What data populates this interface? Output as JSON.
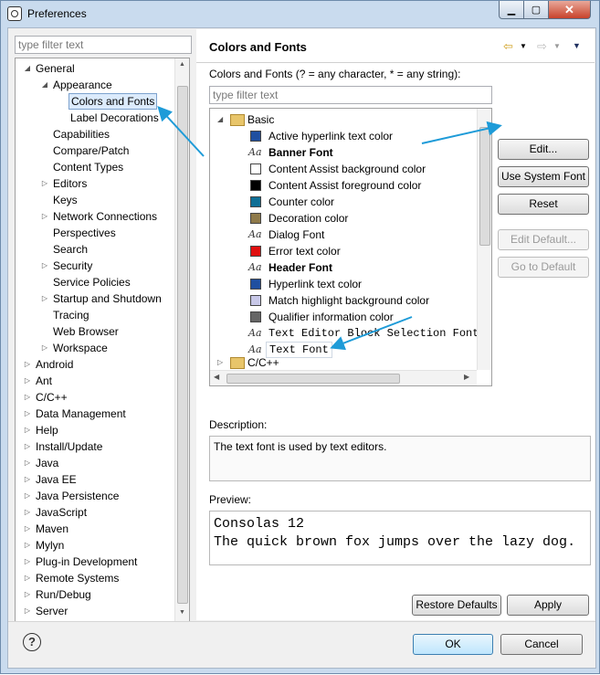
{
  "window": {
    "title": "Preferences"
  },
  "filter_placeholder": "type filter text",
  "tree": [
    {
      "label": "General",
      "level": 0,
      "expander": "down"
    },
    {
      "label": "Appearance",
      "level": 1,
      "expander": "down"
    },
    {
      "label": "Colors and Fonts",
      "level": 2,
      "expander": "",
      "selected": true
    },
    {
      "label": "Label Decorations",
      "level": 2,
      "expander": ""
    },
    {
      "label": "Capabilities",
      "level": 1,
      "expander": ""
    },
    {
      "label": "Compare/Patch",
      "level": 1,
      "expander": ""
    },
    {
      "label": "Content Types",
      "level": 1,
      "expander": ""
    },
    {
      "label": "Editors",
      "level": 1,
      "expander": "right"
    },
    {
      "label": "Keys",
      "level": 1,
      "expander": ""
    },
    {
      "label": "Network Connections",
      "level": 1,
      "expander": "right"
    },
    {
      "label": "Perspectives",
      "level": 1,
      "expander": ""
    },
    {
      "label": "Search",
      "level": 1,
      "expander": ""
    },
    {
      "label": "Security",
      "level": 1,
      "expander": "right"
    },
    {
      "label": "Service Policies",
      "level": 1,
      "expander": ""
    },
    {
      "label": "Startup and Shutdown",
      "level": 1,
      "expander": "right"
    },
    {
      "label": "Tracing",
      "level": 1,
      "expander": ""
    },
    {
      "label": "Web Browser",
      "level": 1,
      "expander": ""
    },
    {
      "label": "Workspace",
      "level": 1,
      "expander": "right"
    },
    {
      "label": "Android",
      "level": 0,
      "expander": "right"
    },
    {
      "label": "Ant",
      "level": 0,
      "expander": "right"
    },
    {
      "label": "C/C++",
      "level": 0,
      "expander": "right"
    },
    {
      "label": "Data Management",
      "level": 0,
      "expander": "right"
    },
    {
      "label": "Help",
      "level": 0,
      "expander": "right"
    },
    {
      "label": "Install/Update",
      "level": 0,
      "expander": "right"
    },
    {
      "label": "Java",
      "level": 0,
      "expander": "right"
    },
    {
      "label": "Java EE",
      "level": 0,
      "expander": "right"
    },
    {
      "label": "Java Persistence",
      "level": 0,
      "expander": "right"
    },
    {
      "label": "JavaScript",
      "level": 0,
      "expander": "right"
    },
    {
      "label": "Maven",
      "level": 0,
      "expander": "right"
    },
    {
      "label": "Mylyn",
      "level": 0,
      "expander": "right"
    },
    {
      "label": "Plug-in Development",
      "level": 0,
      "expander": "right"
    },
    {
      "label": "Remote Systems",
      "level": 0,
      "expander": "right"
    },
    {
      "label": "Run/Debug",
      "level": 0,
      "expander": "right"
    },
    {
      "label": "Server",
      "level": 0,
      "expander": "right"
    }
  ],
  "page": {
    "title": "Colors and Fonts",
    "instructions": "Colors and Fonts (? = any character, * = any string):",
    "filter_placeholder": "type filter text",
    "group_basic": "Basic",
    "group_cpp": "C/C++",
    "items": [
      {
        "label": "Active hyperlink text color",
        "kind": "color",
        "color": "#1f4fa0"
      },
      {
        "label": "Banner Font",
        "kind": "font",
        "style": "bold"
      },
      {
        "label": "Content Assist background color",
        "kind": "color",
        "color": "#ffffff"
      },
      {
        "label": "Content Assist foreground color",
        "kind": "color",
        "color": "#000000"
      },
      {
        "label": "Counter color",
        "kind": "color",
        "color": "#0f6f95"
      },
      {
        "label": "Decoration color",
        "kind": "color",
        "color": "#8f7a4a"
      },
      {
        "label": "Dialog Font",
        "kind": "font",
        "style": "normal"
      },
      {
        "label": "Error text color",
        "kind": "color",
        "color": "#e01010"
      },
      {
        "label": "Header Font",
        "kind": "font",
        "style": "bold"
      },
      {
        "label": "Hyperlink text color",
        "kind": "color",
        "color": "#1f4fa0"
      },
      {
        "label": "Match highlight background color",
        "kind": "color",
        "color": "#c8c8e8"
      },
      {
        "label": "Qualifier information color",
        "kind": "color",
        "color": "#666666"
      },
      {
        "label": "Text Editor Block Selection Font",
        "kind": "font",
        "style": "mono"
      },
      {
        "label": "Text Font",
        "kind": "font",
        "style": "mono",
        "selected": true
      }
    ],
    "buttons": {
      "edit": "Edit...",
      "use_system_font": "Use System Font",
      "reset": "Reset",
      "edit_default": "Edit Default...",
      "go_to_default": "Go to Default"
    },
    "description_label": "Description:",
    "description_text": "The text font is used by text editors.",
    "preview_label": "Preview:",
    "preview_lines": [
      "Consolas 12",
      "The quick brown fox jumps over the lazy dog."
    ],
    "restore_defaults": "Restore Defaults",
    "apply": "Apply"
  },
  "footer": {
    "ok": "OK",
    "cancel": "Cancel"
  },
  "icons": {
    "font_glyph": "Aa",
    "folder": "folder-icon",
    "help": "help-icon"
  }
}
